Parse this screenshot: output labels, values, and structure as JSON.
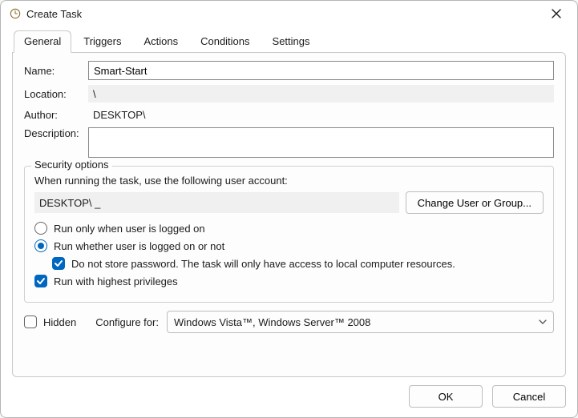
{
  "window": {
    "title": "Create Task"
  },
  "tabs": {
    "general": "General",
    "triggers": "Triggers",
    "actions": "Actions",
    "conditions": "Conditions",
    "settings": "Settings"
  },
  "general": {
    "name_label": "Name:",
    "name_value": "Smart-Start",
    "location_label": "Location:",
    "location_value": "\\",
    "author_label": "Author:",
    "author_value": "DESKTOP\\",
    "description_label": "Description:",
    "description_value": ""
  },
  "security": {
    "legend": "Security options",
    "caption": "When running the task, use the following user account:",
    "account": "DESKTOP\\ _",
    "change_btn": "Change User or Group...",
    "run_logged_on": "Run only when user is logged on",
    "run_whether": "Run whether user is logged on or not",
    "no_store_pwd": "Do not store password.  The task will only have access to local computer resources.",
    "highest_priv": "Run with highest privileges"
  },
  "bottom": {
    "hidden": "Hidden",
    "configure_for_label": "Configure for:",
    "configure_for_value": "Windows Vista™, Windows Server™ 2008"
  },
  "buttons": {
    "ok": "OK",
    "cancel": "Cancel"
  }
}
